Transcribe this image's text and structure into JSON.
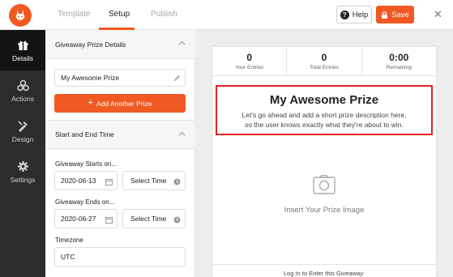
{
  "topbar": {
    "tabs": [
      "Template",
      "Setup",
      "Publish"
    ],
    "active_tab": "Setup",
    "help_label": "Help",
    "save_label": "Save",
    "close_glyph": "✕",
    "accent": "#f05a22"
  },
  "sidebar": {
    "items": [
      {
        "label": "Details",
        "icon": "gift-icon"
      },
      {
        "label": "Actions",
        "icon": "actions-icon"
      },
      {
        "label": "Design",
        "icon": "design-icon"
      },
      {
        "label": "Settings",
        "icon": "gear-icon"
      }
    ]
  },
  "panel": {
    "prize_section_title": "Giveaway Prize Details",
    "prize_name": "My Awesome Prize",
    "add_prize_label": "Add Another Prize",
    "time_section_title": "Start and End Time",
    "starts_label": "Giveaway Starts on...",
    "start_date": "2020-06-13",
    "start_time_placeholder": "Select Time",
    "ends_label": "Giveaway Ends on...",
    "end_date": "2020-06-27",
    "end_time_placeholder": "Select Time",
    "timezone_label": "Timezone",
    "timezone_value": "UTC"
  },
  "preview": {
    "stats": [
      {
        "value": "0",
        "label": "Your Entries"
      },
      {
        "value": "0",
        "label": "Total Entries"
      },
      {
        "value": "0:00",
        "label": "Remaining"
      }
    ],
    "prize_title": "My Awesome Prize",
    "prize_desc_line1": "Let's go ahead and add a short prize description here,",
    "prize_desc_line2": "so the user knows exactly what they're about to win.",
    "image_placeholder": "Insert Your Prize Image",
    "login_text": "Log In to Enter this Giveaway:",
    "highlight_color": "#e02424"
  }
}
